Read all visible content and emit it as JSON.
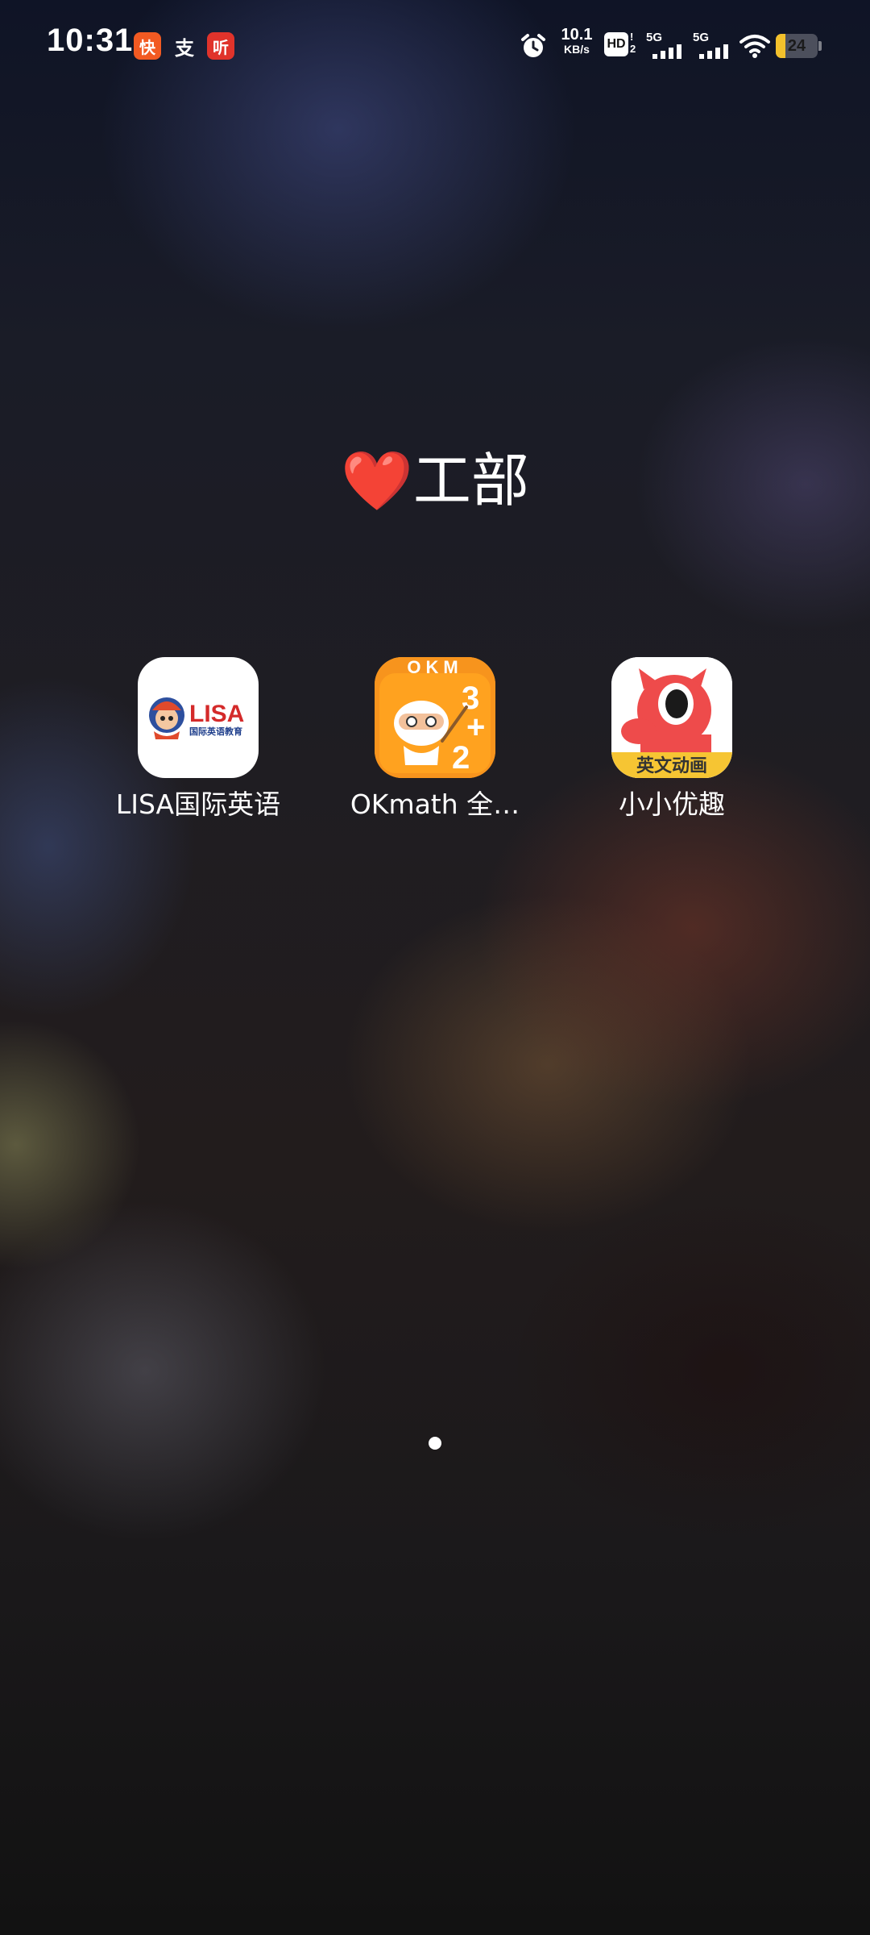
{
  "status_bar": {
    "time": "10:31",
    "notification_icons": [
      "kuaishou-icon",
      "alipay-icon",
      "ting-listen-icon"
    ],
    "notification_glyphs": [
      "快",
      "支",
      "听"
    ],
    "net_speed_value": "10.1",
    "net_speed_unit": "KB/s",
    "hd_label": "HD",
    "sim1_label": "5G",
    "sim2_label": "5G",
    "battery_level": 24,
    "battery_text": "24"
  },
  "folder": {
    "title_emoji": "❤️",
    "title": "工部",
    "apps": [
      {
        "label": "LISA国际英语",
        "icon": "lisa-icon"
      },
      {
        "label": "OKmath 全…",
        "icon": "okmath-icon"
      },
      {
        "label": "小小优趣",
        "icon": "xiaoxiaoyouqu-icon"
      }
    ],
    "lisa_icon_text": "LISA",
    "lisa_icon_subtext": "国际英语教育",
    "okm_icon_text": "OKM",
    "youqu_icon_banner": "英文动画"
  },
  "pagination": {
    "current_page": 1,
    "total_pages": 1
  },
  "colors": {
    "battery_fill": "#f3c12c",
    "heart": "#e62a2a",
    "okmath_orange": "#f7941d",
    "youqu_red": "#ee4b4b",
    "youqu_banner": "#f6c533",
    "lisa_red": "#d42a2a",
    "lisa_navy": "#1f3f8c"
  }
}
